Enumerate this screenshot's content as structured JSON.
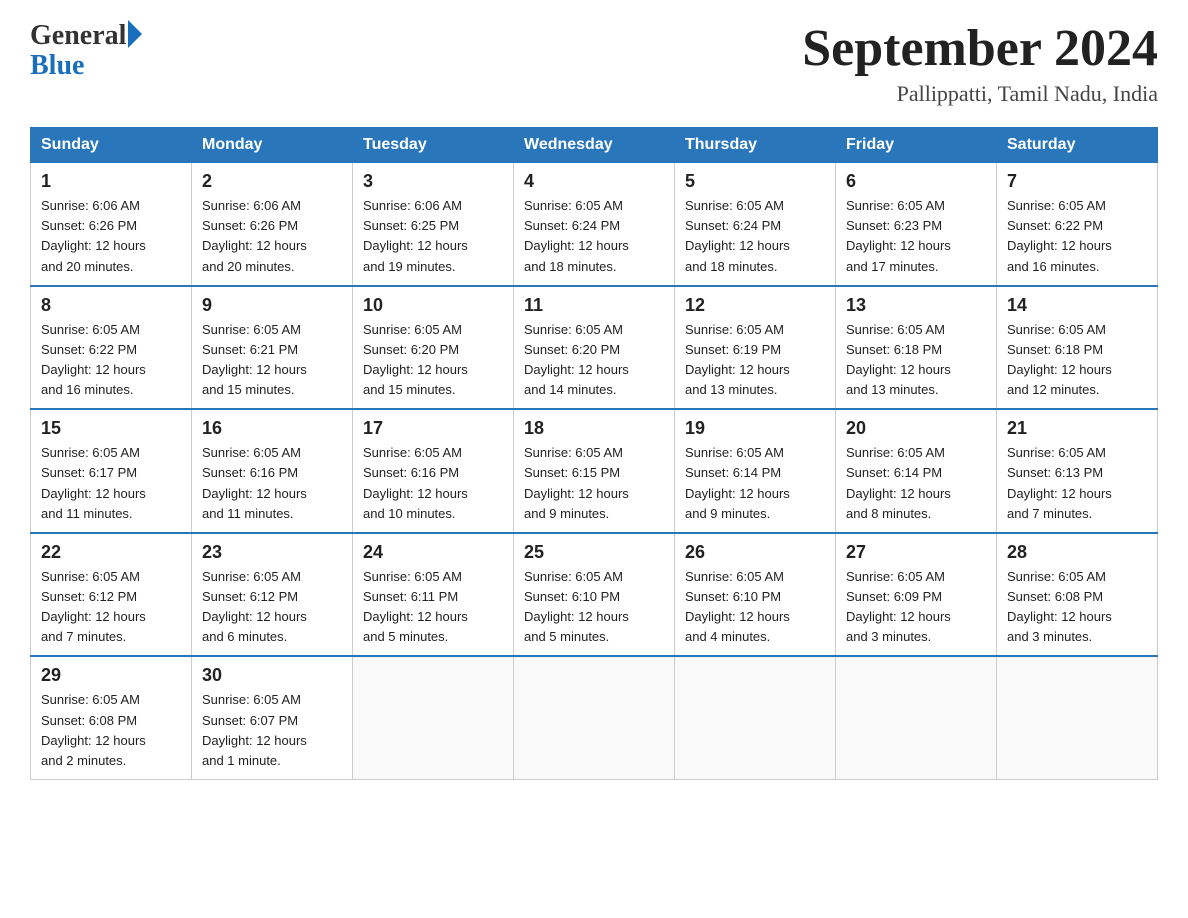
{
  "header": {
    "logo": {
      "text_general": "General",
      "text_blue": "Blue",
      "triangle": "▶"
    },
    "title": "September 2024",
    "subtitle": "Pallippatti, Tamil Nadu, India"
  },
  "weekdays": [
    "Sunday",
    "Monday",
    "Tuesday",
    "Wednesday",
    "Thursday",
    "Friday",
    "Saturday"
  ],
  "weeks": [
    [
      {
        "day": "1",
        "sunrise": "6:06 AM",
        "sunset": "6:26 PM",
        "daylight": "12 hours and 20 minutes."
      },
      {
        "day": "2",
        "sunrise": "6:06 AM",
        "sunset": "6:26 PM",
        "daylight": "12 hours and 20 minutes."
      },
      {
        "day": "3",
        "sunrise": "6:06 AM",
        "sunset": "6:25 PM",
        "daylight": "12 hours and 19 minutes."
      },
      {
        "day": "4",
        "sunrise": "6:05 AM",
        "sunset": "6:24 PM",
        "daylight": "12 hours and 18 minutes."
      },
      {
        "day": "5",
        "sunrise": "6:05 AM",
        "sunset": "6:24 PM",
        "daylight": "12 hours and 18 minutes."
      },
      {
        "day": "6",
        "sunrise": "6:05 AM",
        "sunset": "6:23 PM",
        "daylight": "12 hours and 17 minutes."
      },
      {
        "day": "7",
        "sunrise": "6:05 AM",
        "sunset": "6:22 PM",
        "daylight": "12 hours and 16 minutes."
      }
    ],
    [
      {
        "day": "8",
        "sunrise": "6:05 AM",
        "sunset": "6:22 PM",
        "daylight": "12 hours and 16 minutes."
      },
      {
        "day": "9",
        "sunrise": "6:05 AM",
        "sunset": "6:21 PM",
        "daylight": "12 hours and 15 minutes."
      },
      {
        "day": "10",
        "sunrise": "6:05 AM",
        "sunset": "6:20 PM",
        "daylight": "12 hours and 15 minutes."
      },
      {
        "day": "11",
        "sunrise": "6:05 AM",
        "sunset": "6:20 PM",
        "daylight": "12 hours and 14 minutes."
      },
      {
        "day": "12",
        "sunrise": "6:05 AM",
        "sunset": "6:19 PM",
        "daylight": "12 hours and 13 minutes."
      },
      {
        "day": "13",
        "sunrise": "6:05 AM",
        "sunset": "6:18 PM",
        "daylight": "12 hours and 13 minutes."
      },
      {
        "day": "14",
        "sunrise": "6:05 AM",
        "sunset": "6:18 PM",
        "daylight": "12 hours and 12 minutes."
      }
    ],
    [
      {
        "day": "15",
        "sunrise": "6:05 AM",
        "sunset": "6:17 PM",
        "daylight": "12 hours and 11 minutes."
      },
      {
        "day": "16",
        "sunrise": "6:05 AM",
        "sunset": "6:16 PM",
        "daylight": "12 hours and 11 minutes."
      },
      {
        "day": "17",
        "sunrise": "6:05 AM",
        "sunset": "6:16 PM",
        "daylight": "12 hours and 10 minutes."
      },
      {
        "day": "18",
        "sunrise": "6:05 AM",
        "sunset": "6:15 PM",
        "daylight": "12 hours and 9 minutes."
      },
      {
        "day": "19",
        "sunrise": "6:05 AM",
        "sunset": "6:14 PM",
        "daylight": "12 hours and 9 minutes."
      },
      {
        "day": "20",
        "sunrise": "6:05 AM",
        "sunset": "6:14 PM",
        "daylight": "12 hours and 8 minutes."
      },
      {
        "day": "21",
        "sunrise": "6:05 AM",
        "sunset": "6:13 PM",
        "daylight": "12 hours and 7 minutes."
      }
    ],
    [
      {
        "day": "22",
        "sunrise": "6:05 AM",
        "sunset": "6:12 PM",
        "daylight": "12 hours and 7 minutes."
      },
      {
        "day": "23",
        "sunrise": "6:05 AM",
        "sunset": "6:12 PM",
        "daylight": "12 hours and 6 minutes."
      },
      {
        "day": "24",
        "sunrise": "6:05 AM",
        "sunset": "6:11 PM",
        "daylight": "12 hours and 5 minutes."
      },
      {
        "day": "25",
        "sunrise": "6:05 AM",
        "sunset": "6:10 PM",
        "daylight": "12 hours and 5 minutes."
      },
      {
        "day": "26",
        "sunrise": "6:05 AM",
        "sunset": "6:10 PM",
        "daylight": "12 hours and 4 minutes."
      },
      {
        "day": "27",
        "sunrise": "6:05 AM",
        "sunset": "6:09 PM",
        "daylight": "12 hours and 3 minutes."
      },
      {
        "day": "28",
        "sunrise": "6:05 AM",
        "sunset": "6:08 PM",
        "daylight": "12 hours and 3 minutes."
      }
    ],
    [
      {
        "day": "29",
        "sunrise": "6:05 AM",
        "sunset": "6:08 PM",
        "daylight": "12 hours and 2 minutes."
      },
      {
        "day": "30",
        "sunrise": "6:05 AM",
        "sunset": "6:07 PM",
        "daylight": "12 hours and 1 minute."
      },
      null,
      null,
      null,
      null,
      null
    ]
  ],
  "labels": {
    "sunrise": "Sunrise:",
    "sunset": "Sunset:",
    "daylight": "Daylight:"
  }
}
